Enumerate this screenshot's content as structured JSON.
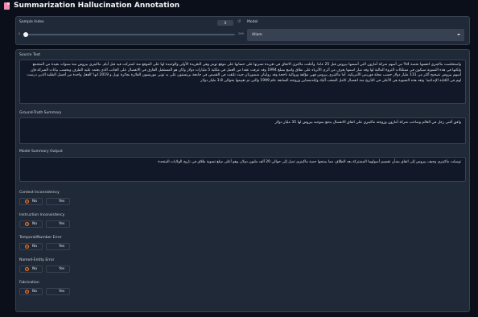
{
  "app": {
    "title": "Summarization Hallucination Annotation",
    "icon": "document-icon"
  },
  "sample_index": {
    "label": "Sample Index",
    "value": "0",
    "min": "0",
    "max": "299",
    "fraction": 0.0
  },
  "model": {
    "label": "Model",
    "value": "Allam"
  },
  "source_text": {
    "label": "Source Text",
    "value": "واستخلصت ماكينزي انفسها بحصة 4% من أسهم شركة أمازون التي أسسها بيزوس قبل 25 عاما. وأعلنت ماكنزي الاتفاق في تغريدة نشرتها على حسابها على موقع تويتر وهي التغريدة الأولى والوحيدة لها على الموقع منذ اشتركت فيه قبل أيام. ماكينزي بيزوس منذ سنوات بعيدة من المجتمع ولكنها في هذه التسوية سيكون في ممتلكات الثروة المالية لها وقد صار اسمها يعرف من أثرى الأثرياء على نطاق واسع بمبلغ 1994 وقد عرفت عقدا من العمل في ملكية 5 مليارات دولار وكان هو المستقبل الفارق في الانفصال على الجانب الذي يعتمد عليه الطرف وبحسب بيانات الشركة فإن أسهم بيزوس تصحيح أكثر من 131 مليار دولار حسب مجلة فوربس الأمريكية. أما ماكينزي بيزوس فهي مؤلفة وروائية ناجحة وقد روايتان منشورتان حيث تلتقت في القصص في جامعة برينستون على يد توني موريسون الفائزة بجائزة نوبل و 2019 انها 'الفعل واحدة من أفضل الطلبة الذين درست لهم في الكتابة الإبداعية' وتعد هذه التسوية هي الأعلى في التاريخ منذ انفصال كامل الشعب أليك وايلدنستاين وزوجته السابقة عام 1999 والتي تم تقييمها بحوالي 3.8 مليار دولار"
  },
  "ground_truth": {
    "label": "Ground-Truth Summary",
    "value": "وافق أغنى رجل في العالم وصاحب شركة أمازون وزوجته ماكينزي على اتفاق الانفصال يدفع بموجبه بيزوس لها 35 مليار دولار"
  },
  "model_output": {
    "label": "Model Summary Output",
    "value": "توصلت ماكينزي وجيف بيزوس إلى اتفاق بشأن تقسيم أصولهما المشتركة بعد الطلاق، مما يمنحها حصة ماكينزي تصل إلى حوالي 20 ألف مليون دولار، وهو أعلى مبلغ تسوية طلاق في تاريخ الولايات المتحدة"
  },
  "questions": [
    {
      "label": "Context Inconsistency",
      "options": [
        "No",
        "Yes"
      ],
      "selected": "No"
    },
    {
      "label": "Instruction Inconsistency",
      "options": [
        "No",
        "Yes"
      ],
      "selected": "No"
    },
    {
      "label": "Temporal/Number Error",
      "options": [
        "No",
        "Yes"
      ],
      "selected": "No"
    },
    {
      "label": "Named-Entity Error",
      "options": [
        "No",
        "Yes"
      ],
      "selected": "No"
    },
    {
      "label": "Fabrication",
      "options": [
        "No",
        "Yes"
      ],
      "selected": "No"
    }
  ],
  "colors": {
    "accent": "#f97316",
    "background": "#0b0f19",
    "panel": "#1f2937"
  }
}
